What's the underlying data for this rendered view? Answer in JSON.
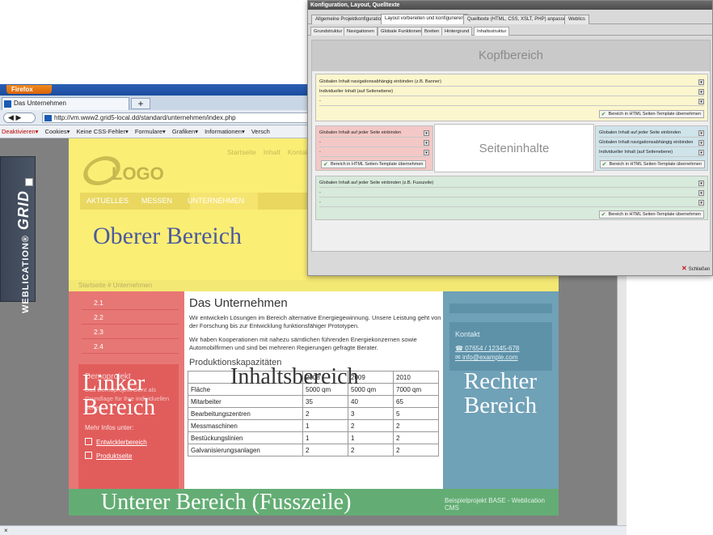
{
  "browser": {
    "app_button": "Firefox",
    "tab_title": "Das Unternehmen",
    "new_tab": "+",
    "url": "http://vm.www2.grid5-local.dd/standard/unternehmen/index.php",
    "toolbar": [
      "Deaktivieren▾",
      "Cookies▾",
      "Keine CSS-Fehler▾",
      "Formulare▾",
      "Grafiken▾",
      "Informationen▾",
      "Versch"
    ],
    "status": "×"
  },
  "sidebar": {
    "brand": "WEBLICATION®",
    "grid": "GRID"
  },
  "site": {
    "logo": "LOGO",
    "top_links": [
      "Startseite",
      "Inhalt",
      "Kontakt"
    ],
    "nav": [
      "AKTUELLES",
      "MESSEN",
      "UNTERNEHMEN"
    ],
    "oberer_label": "Oberer Bereich",
    "breadcrumb": "Startseite # Unternehmen",
    "left_nav": [
      "2.1",
      "2.2",
      "2.3",
      "2.4"
    ],
    "demo_title": "Demoprojekt",
    "demo_text": "Das Demoprojekt dient als Grundlage für Ihre individuellen Seiten.",
    "more_info": "Mehr Infos unter:",
    "link1": "Entwicklerbereich",
    "link2": "Produktseite",
    "linker_label": "Linker Bereich",
    "content_title": "Das Unternehmen",
    "content_p1": "Wir entwickeln Lösungen im Bereich alternative Energiegewinnung. Unsere Leistung geht von der Forschung bis zur Entwicklung funktionsfähiger Prototypen.",
    "content_p2": "Wir haben Kooperationen mit nahezu sämtlichen führenden Energiekonzernen sowie Automobilfirmen und sind bei mehreren Regierungen gefragte Berater.",
    "content_sub": "Produktionskapazitäten",
    "inhalts_label": "Inhaltsbereich",
    "table": [
      [
        "",
        "2008",
        "2009",
        "2010"
      ],
      [
        "Fläche",
        "5000 qm",
        "5000 qm",
        "7000 qm"
      ],
      [
        "Mitarbeiter",
        "35",
        "40",
        "65"
      ],
      [
        "Bearbeitungszentren",
        "2",
        "3",
        "5"
      ],
      [
        "Messmaschinen",
        "1",
        "2",
        "2"
      ],
      [
        "Bestückungslinien",
        "1",
        "1",
        "2"
      ],
      [
        "Galvanisierungsanlagen",
        "2",
        "2",
        "2"
      ]
    ],
    "kontakt_title": "Kontakt",
    "phone": "07654 / 12345-678",
    "email": "info@example.com",
    "rechter_label": "Rechter Bereich",
    "footer_cms": "Beispielprojekt BASE - Weblication CMS",
    "unterer_label": "Unterer Bereich (Fusszeile)"
  },
  "dialog": {
    "title": "Konfiguration, Layout, Quelltexte",
    "tabs": [
      "Allgemeine Projektkonfiguration",
      "Layout vorbereiten und konfigurieren",
      "Quelltexte (HTML, CSS, XSLT, PHP) anpassen",
      "Weblics"
    ],
    "subtabs": [
      "Grundstruktur",
      "Navigationen",
      "Globale Funktionen",
      "Breiten",
      "Hintergrund",
      "Inhaltsstruktur"
    ],
    "kopf": "Kopfbereich",
    "seiten": "Seiteninhalte",
    "yellow_rows": [
      "Globalen Inhalt navigationsabhängig einbinden (z.B. Banner)",
      "Individueller Inhalt (auf Seitenebene)",
      "-"
    ],
    "red_rows": [
      "Globalen Inhalt auf jeder Seite einbinden",
      "-",
      "-"
    ],
    "blue_rows": [
      "Globalen Inhalt auf jeder Seite einbinden",
      "Globalen Inhalt navigationsabhängig einbinden",
      "Individueller Inhalt (auf Seitenebene)"
    ],
    "green_rows": [
      "Globalen Inhalt auf jeder Seite einbinden (z.B. Fusszeile)",
      "-",
      "-"
    ],
    "apply": "Bereich in HTML Seiten-Template übernehmen",
    "close": "Schließen"
  },
  "colors": {
    "top": "#fbee75",
    "left": "#e77775",
    "right": "#6fa1b7",
    "bottom": "#63ad74"
  }
}
